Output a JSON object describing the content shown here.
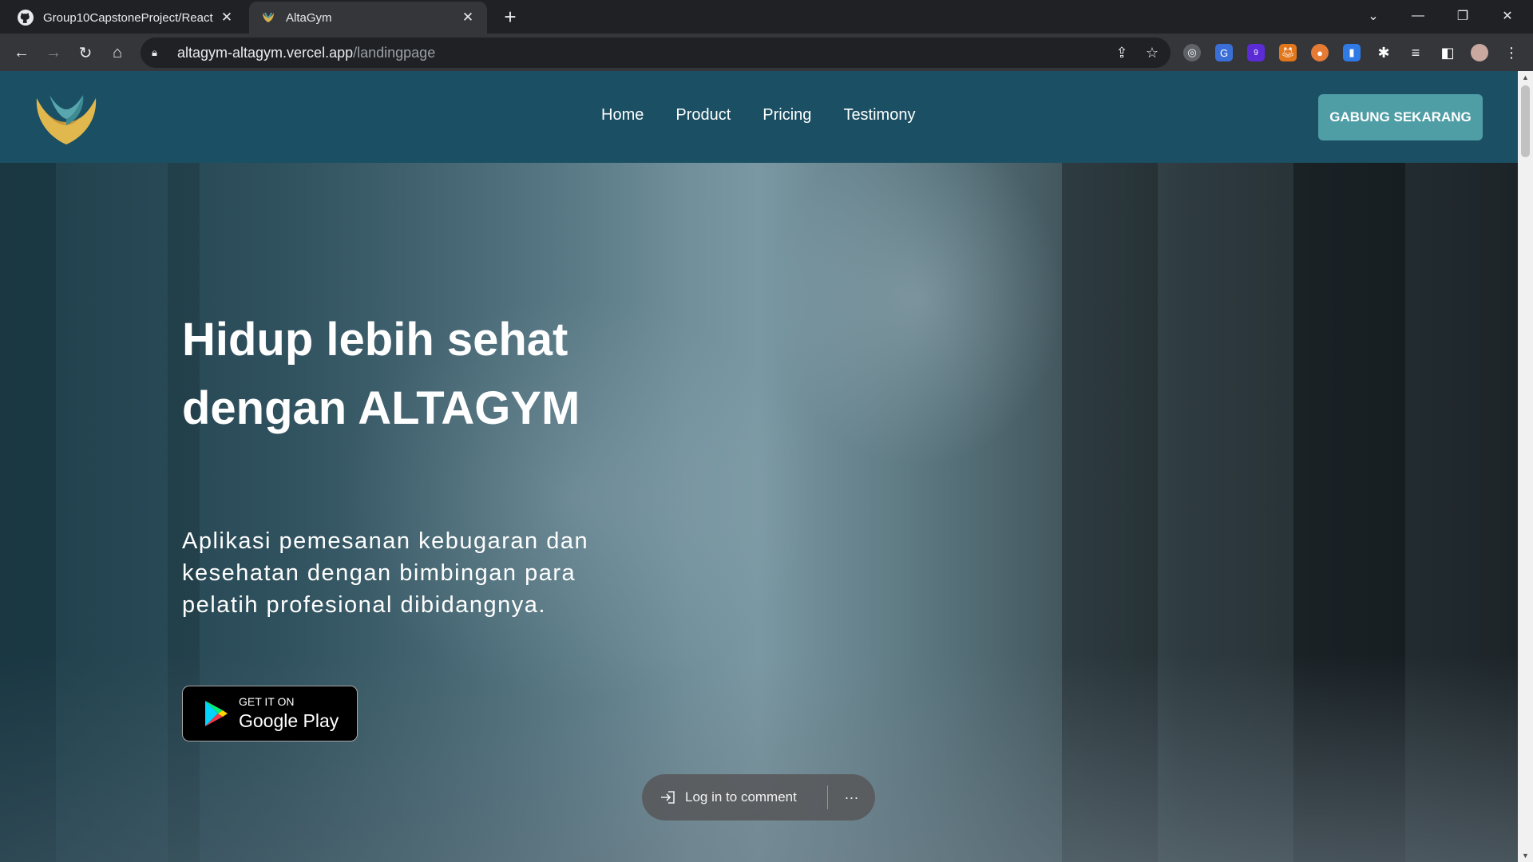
{
  "browser": {
    "tabs": [
      {
        "title": "Group10CapstoneProject/React",
        "icon": "github-icon",
        "active": false
      },
      {
        "title": "AltaGym",
        "icon": "altagym-favicon",
        "active": true
      }
    ],
    "new_tab": "+",
    "address": {
      "host": "altagym-altagym.vercel.app",
      "path": "/landingpage"
    },
    "extension_badge": "9"
  },
  "site": {
    "nav": {
      "links": [
        "Home",
        "Product",
        "Pricing",
        "Testimony"
      ],
      "cta": "GABUNG SEKARANG"
    },
    "hero": {
      "headline_line1": "Hidup lebih sehat",
      "headline_line2": "dengan ALTAGYM",
      "subtitle": "Aplikasi pemesanan kebugaran dan kesehatan dengan bimbingan para pelatih profesional dibidangnya.",
      "store_badge": {
        "small": "GET IT ON",
        "big": "Google Play"
      }
    },
    "comment_widget": {
      "login_label": "Log in to comment",
      "more": "···"
    }
  },
  "colors": {
    "navbar": "#1b4f63",
    "cta": "#4f9da5",
    "chrome_tabbar": "#202124",
    "chrome_toolbar": "#35363a"
  }
}
